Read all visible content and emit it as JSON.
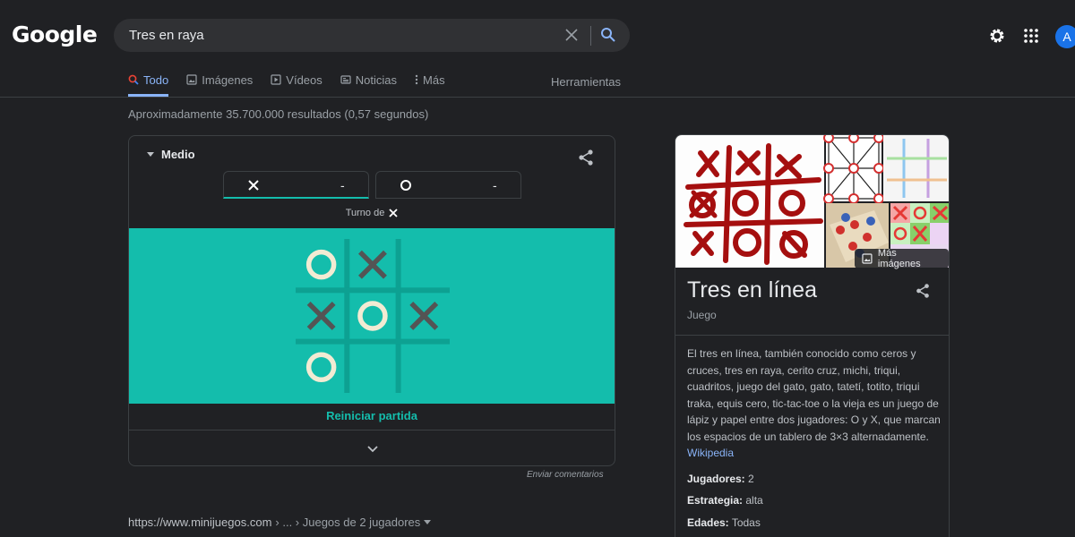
{
  "header": {
    "logo": "Google",
    "search_value": "Tres en raya",
    "avatar_letter": "A"
  },
  "tabs": [
    {
      "label": "Todo",
      "icon": "search-icon"
    },
    {
      "label": "Imágenes",
      "icon": "image-icon"
    },
    {
      "label": "Vídeos",
      "icon": "play-icon"
    },
    {
      "label": "Noticias",
      "icon": "news-icon"
    },
    {
      "label": "Más",
      "icon": "more-vert-icon"
    }
  ],
  "tools_label": "Herramientas",
  "result_stats": "Aproximadamente 35.700.000 resultados (0,57 segundos)",
  "game": {
    "difficulty": "Medio",
    "player_x_score": "-",
    "player_o_score": "-",
    "turn_label": "Turno de",
    "board": [
      [
        "O",
        "X",
        ""
      ],
      [
        "X",
        "O",
        "X"
      ],
      [
        "O",
        "",
        ""
      ]
    ],
    "restart_label": "Reiniciar partida",
    "feedback_label": "Enviar comentarios",
    "colors": {
      "board_bg": "#14bdac",
      "o_mark": "#f2ebd3",
      "x_mark": "#545454",
      "grid": "#0da192"
    }
  },
  "result": {
    "url": "https://www.minijuegos.com",
    "breadcrumb": "› ... › Juegos de 2 jugadores"
  },
  "knowledge_panel": {
    "more_images_label": "Más imágenes",
    "title": "Tres en línea",
    "subtitle": "Juego",
    "description": "El tres en línea, también conocido como ceros y cruces, tres en raya, cerito cruz, michi, triqui, cuadritos, juego del gato, gato, tatetí, totito, triqui traka, equis cero, tic-tac-toe o la vieja es un juego de lápiz y papel entre dos jugadores: O y X, que marcan los espacios de un tablero de 3×3 alternadamente.",
    "source_link": "Wikipedia",
    "facts": [
      {
        "label": "Jugadores:",
        "value": "2"
      },
      {
        "label": "Estrategia:",
        "value": "alta"
      },
      {
        "label": "Edades:",
        "value": "Todas"
      }
    ]
  }
}
